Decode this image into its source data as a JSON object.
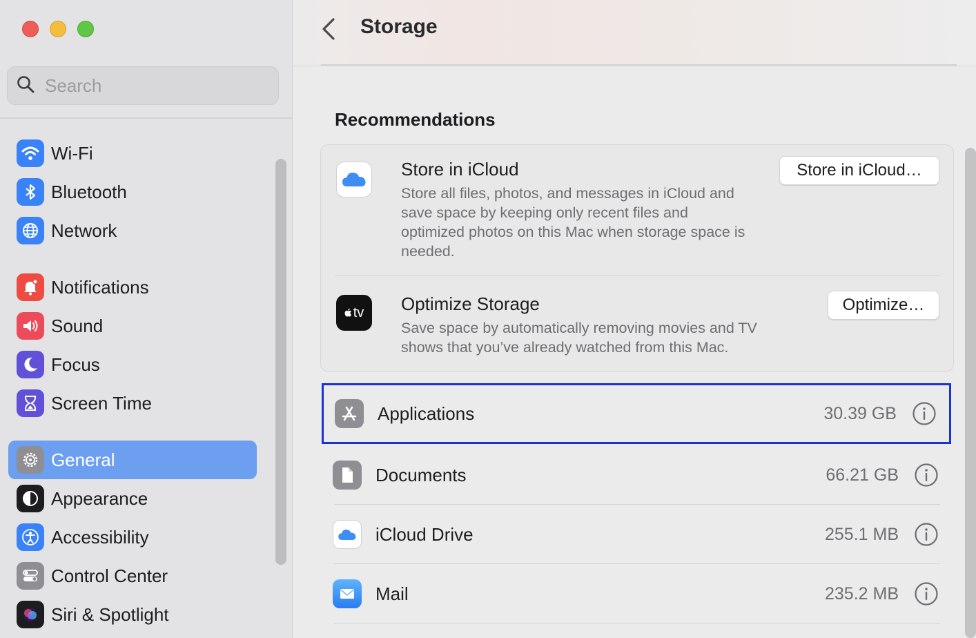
{
  "window": {
    "traffic_lights": [
      "close",
      "minimize",
      "zoom"
    ]
  },
  "search": {
    "placeholder": "Search"
  },
  "sidebar": {
    "items": [
      {
        "label": "Wi-Fi",
        "icon": "wifi-icon",
        "color": "#3a82f7"
      },
      {
        "label": "Bluetooth",
        "icon": "bluetooth-icon",
        "color": "#3a82f7"
      },
      {
        "label": "Network",
        "icon": "globe-icon",
        "color": "#3a82f7"
      },
      {
        "label": "Notifications",
        "icon": "bell-icon",
        "color": "#ee4b43"
      },
      {
        "label": "Sound",
        "icon": "speaker-icon",
        "color": "#ee4b5a"
      },
      {
        "label": "Focus",
        "icon": "moon-icon",
        "color": "#6151d8"
      },
      {
        "label": "Screen Time",
        "icon": "hourglass-icon",
        "color": "#6151d8"
      },
      {
        "label": "General",
        "icon": "gear-icon",
        "color": "#8e8e93",
        "selected": true
      },
      {
        "label": "Appearance",
        "icon": "appearance-icon",
        "color": "#1d1d1f"
      },
      {
        "label": "Accessibility",
        "icon": "accessibility-icon",
        "color": "#3a82f7"
      },
      {
        "label": "Control Center",
        "icon": "toggles-icon",
        "color": "#8e8e93"
      },
      {
        "label": "Siri & Spotlight",
        "icon": "siri-icon",
        "color": "#1d1d1f"
      }
    ]
  },
  "header": {
    "title": "Storage",
    "back_icon": "chevron-left-icon"
  },
  "recommendations": {
    "title": "Recommendations",
    "items": [
      {
        "title": "Store in iCloud",
        "description_lines": [
          "Store all files, photos, and messages in iCloud and",
          "save space by keeping only recent files and",
          "optimized photos on this Mac when storage space is",
          "needed."
        ],
        "button": "Store in iCloud…",
        "icon": "icloud-icon"
      },
      {
        "title": "Optimize Storage",
        "description_lines": [
          "Save space by automatically removing movies and TV",
          "shows that you’ve already watched from this Mac."
        ],
        "button": "Optimize…",
        "icon": "appletv-icon",
        "icon_text": "tv"
      }
    ]
  },
  "storage": {
    "items": [
      {
        "label": "Applications",
        "size": "30.39 GB",
        "icon": "app-store-icon",
        "highlighted": true
      },
      {
        "label": "Documents",
        "size": "66.21 GB",
        "icon": "document-icon"
      },
      {
        "label": "iCloud Drive",
        "size": "255.1 MB",
        "icon": "icloud-drive-icon"
      },
      {
        "label": "Mail",
        "size": "235.2 MB",
        "icon": "mail-icon"
      }
    ]
  },
  "colors": {
    "selection": "#6c9ff0",
    "highlight_border": "#1733d8"
  }
}
